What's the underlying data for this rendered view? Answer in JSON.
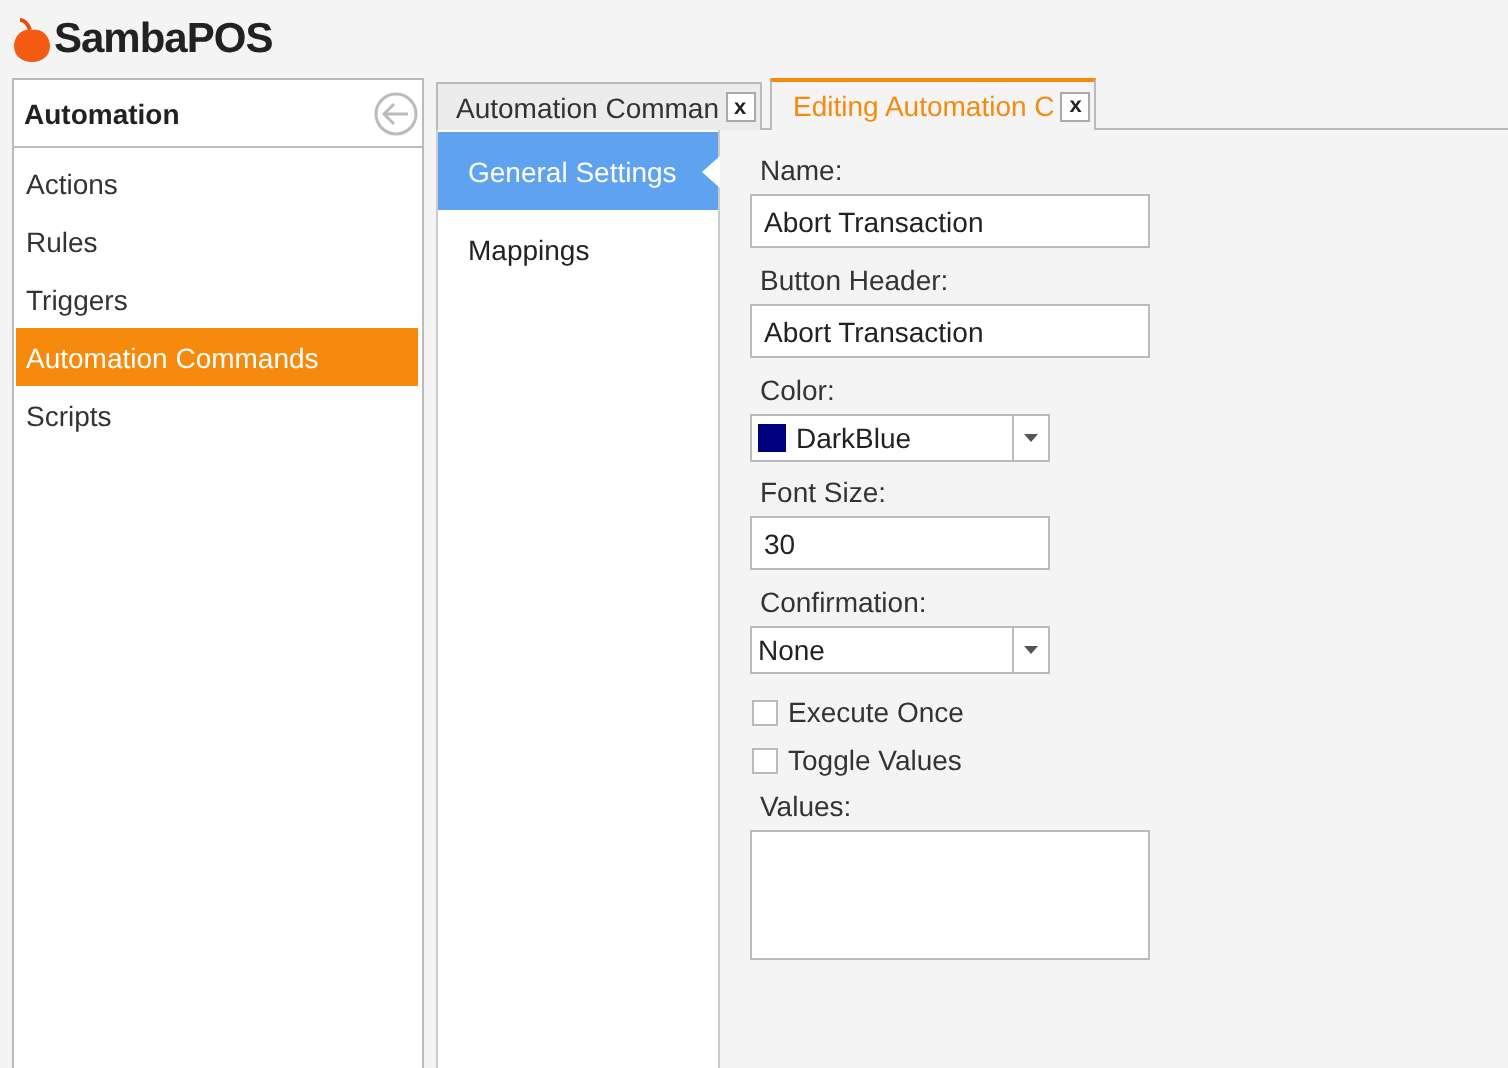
{
  "app": {
    "logo_text": "SambaPOS"
  },
  "sidebar": {
    "title": "Automation",
    "items": [
      {
        "label": "Actions",
        "selected": false
      },
      {
        "label": "Rules",
        "selected": false
      },
      {
        "label": "Triggers",
        "selected": false
      },
      {
        "label": "Automation Commands",
        "selected": true
      },
      {
        "label": "Scripts",
        "selected": false
      }
    ]
  },
  "tabs": [
    {
      "label": "Automation Comman",
      "close": "x",
      "selected": false
    },
    {
      "label": "Editing Automation C",
      "close": "x",
      "selected": true
    }
  ],
  "sections": [
    {
      "label": "General Settings",
      "selected": true
    },
    {
      "label": "Mappings",
      "selected": false
    }
  ],
  "form": [
    {
      "kind": "text",
      "label": "Name:",
      "value": "Abort Transaction"
    },
    {
      "kind": "text",
      "label": "Button Header:",
      "value": "Abort Transaction"
    },
    {
      "kind": "color",
      "label": "Color:",
      "value": "DarkBlue",
      "color": "#000080"
    },
    {
      "kind": "short",
      "label": "Font Size:",
      "value": "30"
    },
    {
      "kind": "select",
      "label": "Confirmation:",
      "value": "None"
    },
    {
      "kind": "checkbox",
      "label": "Execute Once",
      "checked": false
    },
    {
      "kind": "checkbox",
      "label": "Toggle Values",
      "checked": false
    },
    {
      "kind": "textarea",
      "label": "Values:"
    }
  ]
}
